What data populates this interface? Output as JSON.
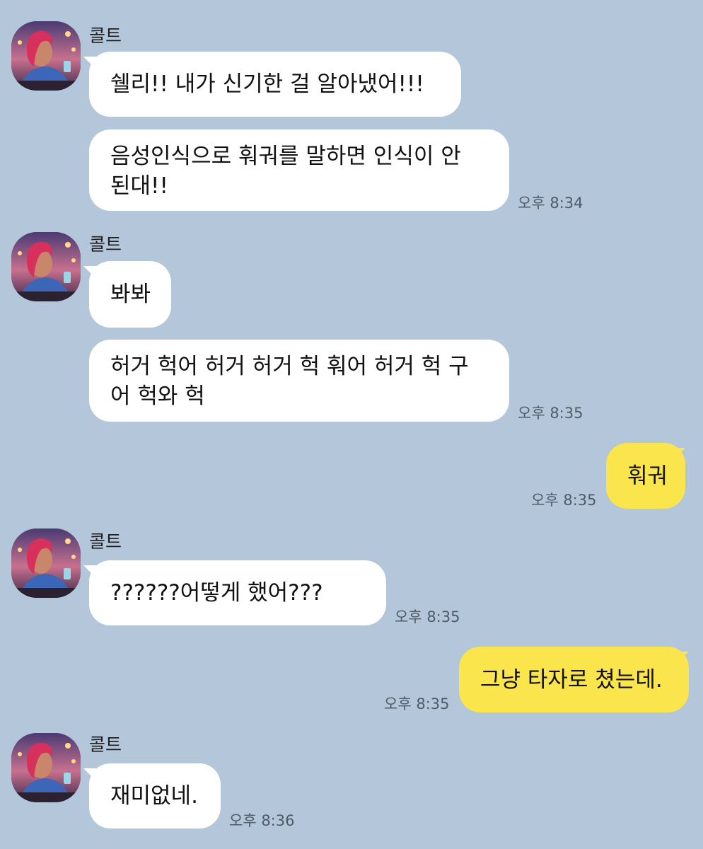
{
  "sender_name": "콜트",
  "avatar_icon": "profile-avatar",
  "colors": {
    "background": "#b3c6da",
    "incoming_bubble": "#ffffff",
    "outgoing_bubble": "#fbe54c"
  },
  "groups": [
    {
      "sender": "콜트",
      "messages": [
        {
          "text": "쉘리!! 내가 신기한 걸 알아냈어!!!"
        },
        {
          "text": "음성인식으로 훠궈를 말하면 인식이 안 된대!!",
          "time": "오후 8:34"
        }
      ]
    },
    {
      "sender": "콜트",
      "messages": [
        {
          "text": "봐봐"
        },
        {
          "text": "허거 헉어 허거 허거 헉 훠어 허거 헉 구어 헉와 헉",
          "time": "오후 8:35"
        }
      ]
    },
    {
      "sender": "me",
      "messages": [
        {
          "text": "훠궈",
          "time": "오후 8:35"
        }
      ]
    },
    {
      "sender": "콜트",
      "messages": [
        {
          "text": "??????어떻게 했어???",
          "time": "오후 8:35"
        }
      ]
    },
    {
      "sender": "me",
      "messages": [
        {
          "text": "그냥 타자로 쳤는데.",
          "time": "오후 8:35"
        }
      ]
    },
    {
      "sender": "콜트",
      "messages": [
        {
          "text": "재미없네.",
          "time": "오후 8:36"
        }
      ]
    }
  ]
}
